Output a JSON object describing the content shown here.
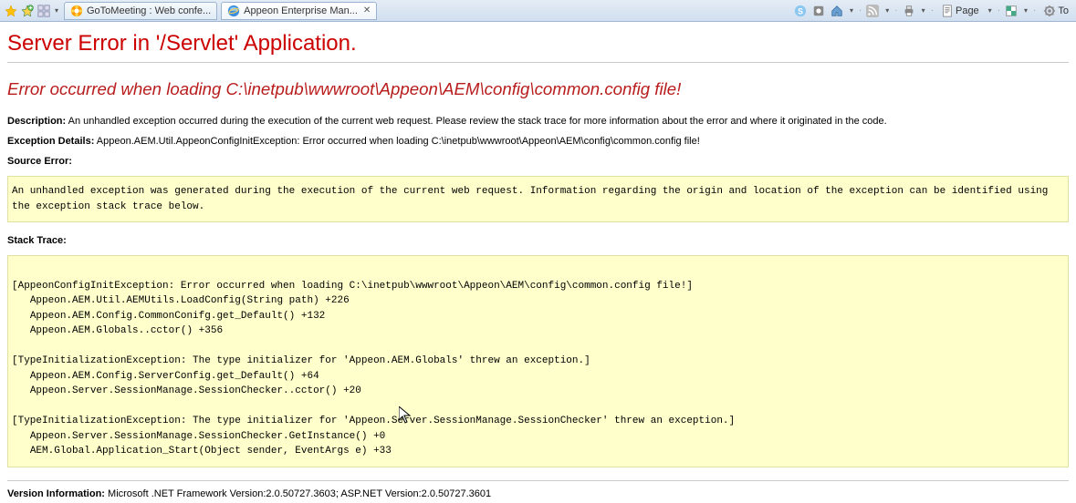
{
  "toolbar": {
    "tabs": [
      {
        "label": "GoToMeeting : Web confe...",
        "active": false
      },
      {
        "label": "Appeon Enterprise Man...",
        "active": true
      }
    ],
    "page_menu": "Page",
    "tools_menu": "To"
  },
  "error_page": {
    "title": "Server Error in '/Servlet' Application.",
    "error_heading": "Error occurred when loading C:\\inetpub\\wwwroot\\Appeon\\AEM\\config\\common.config file!",
    "description_label": "Description:",
    "description_text": " An unhandled exception occurred during the execution of the current web request. Please review the stack trace for more information about the error and where it originated in the code.",
    "exception_label": "Exception Details:",
    "exception_text": " Appeon.AEM.Util.AppeonConfigInitException: Error occurred when loading C:\\inetpub\\wwwroot\\Appeon\\AEM\\config\\common.config file!",
    "source_error_label": "Source Error:",
    "source_error_text": "An unhandled exception was generated during the execution of the current web request. Information regarding the origin and location of the exception can be identified using the exception stack trace below.",
    "stack_trace_label": "Stack Trace:",
    "stack_trace_text": "\n[AppeonConfigInitException: Error occurred when loading C:\\inetpub\\wwwroot\\Appeon\\AEM\\config\\common.config file!]\n   Appeon.AEM.Util.AEMUtils.LoadConfig(String path) +226\n   Appeon.AEM.Config.CommonConifg.get_Default() +132\n   Appeon.AEM.Globals..cctor() +356\n\n[TypeInitializationException: The type initializer for 'Appeon.AEM.Globals' threw an exception.]\n   Appeon.AEM.Config.ServerConfig.get_Default() +64\n   Appeon.Server.SessionManage.SessionChecker..cctor() +20\n\n[TypeInitializationException: The type initializer for 'Appeon.Server.SessionManage.SessionChecker' threw an exception.]\n   Appeon.Server.SessionManage.SessionChecker.GetInstance() +0\n   AEM.Global.Application_Start(Object sender, EventArgs e) +33\n",
    "version_label": "Version Information:",
    "version_text": " Microsoft .NET Framework Version:2.0.50727.3603; ASP.NET Version:2.0.50727.3601"
  }
}
